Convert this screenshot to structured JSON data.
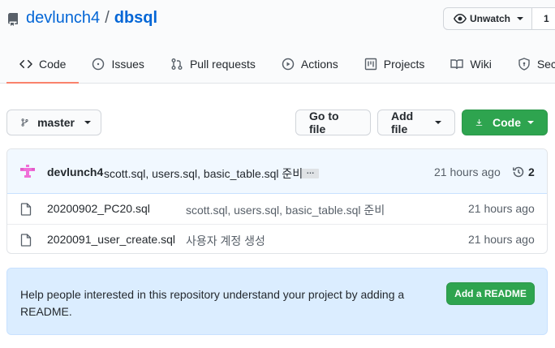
{
  "repo": {
    "owner": "devlunch4",
    "separator": "/",
    "name": "dbsql",
    "icon": "repo-icon"
  },
  "watch": {
    "label": "Unwatch",
    "count": "1",
    "icon": "eye-icon"
  },
  "tabs": [
    {
      "label": "Code",
      "icon": "code-icon",
      "selected": true
    },
    {
      "label": "Issues",
      "icon": "issue-icon"
    },
    {
      "label": "Pull requests",
      "icon": "pull-request-icon"
    },
    {
      "label": "Actions",
      "icon": "play-icon"
    },
    {
      "label": "Projects",
      "icon": "project-icon"
    },
    {
      "label": "Wiki",
      "icon": "book-icon"
    },
    {
      "label": "Security",
      "icon": "shield-icon"
    }
  ],
  "toolbar": {
    "branch": "master",
    "go_to_file": "Go to file",
    "add_file": "Add file",
    "code": "Code"
  },
  "latest_commit": {
    "author": "devlunch4",
    "message": "scott.sql, users.sql, basic_table.sql 준비",
    "ellipsis": "…",
    "time": "21 hours ago",
    "history_count": "2"
  },
  "files": [
    {
      "name": "20200902_PC20.sql",
      "message": "scott.sql, users.sql, basic_table.sql 준비",
      "time": "21 hours ago"
    },
    {
      "name": "2020091_user_create.sql",
      "message": "사용자 계정 생성",
      "time": "21 hours ago"
    }
  ],
  "readme": {
    "text": "Help people interested in this repository understand your project by adding a README.",
    "button": "Add a README"
  },
  "colors": {
    "link": "#0366d6",
    "primary_button": "#2ea44f",
    "selected_tab_underline": "#f9826c",
    "readme_bg": "#dbedff"
  }
}
